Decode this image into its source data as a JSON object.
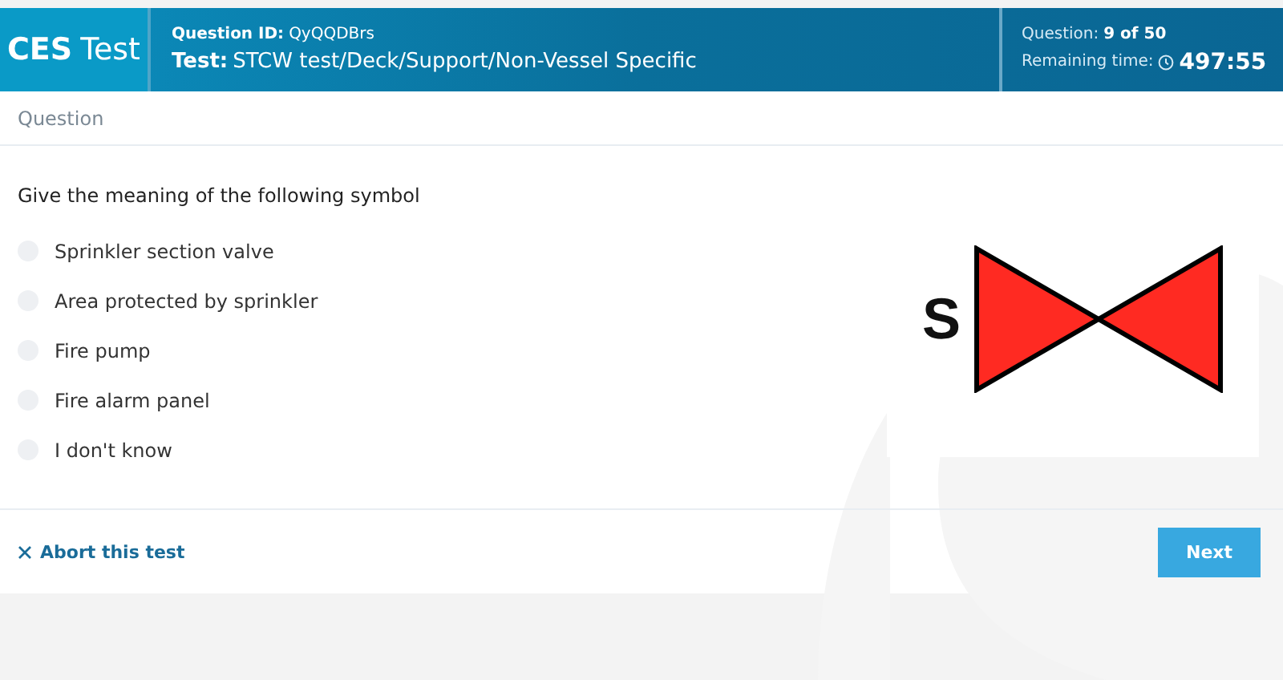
{
  "header": {
    "brand_bold": "CES",
    "brand_light": "Test",
    "question_id_label": "Question ID:",
    "question_id": "QyQQDBrs",
    "test_label": "Test:",
    "test_name": "STCW test/Deck/Support/Non-Vessel Specific",
    "counter_label": "Question:",
    "counter_value": "9 of 50",
    "time_label": "Remaining time:",
    "time_value": "497:55"
  },
  "section_title": "Question",
  "question": "Give the meaning of the following symbol",
  "options": [
    {
      "label": "Sprinkler section valve",
      "selected": false
    },
    {
      "label": "Area protected by sprinkler",
      "selected": false
    },
    {
      "label": "Fire pump",
      "selected": false
    },
    {
      "label": "Fire alarm panel",
      "selected": false
    },
    {
      "label": "I don't know",
      "selected": false
    }
  ],
  "symbol": {
    "label": "S"
  },
  "footer": {
    "abort": "Abort this test",
    "next": "Next"
  }
}
